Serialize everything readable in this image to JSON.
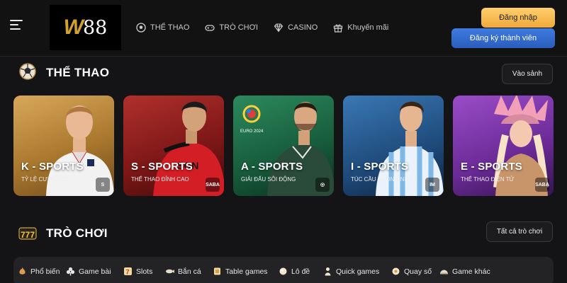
{
  "header": {
    "logo_text_w": "W",
    "logo_text_num": "88",
    "nav": [
      {
        "label": "THỂ THAO",
        "icon": "soccer-ball-icon"
      },
      {
        "label": "TRÒ CHƠI",
        "icon": "gamepad-icon"
      },
      {
        "label": "CASINO",
        "icon": "diamond-icon"
      },
      {
        "label": "Khuyến mãi",
        "icon": "gift-icon"
      }
    ],
    "login_label": "Đăng nhập",
    "register_label": "Đăng ký thành viên"
  },
  "sports": {
    "title": "THỂ THAO",
    "button": "Vào sảnh",
    "cards": [
      {
        "title": "K - SPORTS",
        "subtitle": "TỶ LỆ CƯỢC TỐT",
        "badge": "S",
        "color": "#b98a3a"
      },
      {
        "title": "S - SPORTS",
        "subtitle": "THỂ THAO ĐỈNH CAO",
        "badge": "SABA",
        "color": "#9c2a2a"
      },
      {
        "title": "A - SPORTS",
        "subtitle": "GIẢI ĐẤU SÔI ĐỘNG",
        "badge": "◎",
        "color": "#1f6b48"
      },
      {
        "title": "I - SPORTS",
        "subtitle": "TÚC CẦU CUỒNG NHIỆT",
        "badge": "IM",
        "color": "#2c5a86"
      },
      {
        "title": "E - SPORTS",
        "subtitle": "THỂ THAO ĐIỆN TỬ",
        "badge": "SABA",
        "color": "#7a3aa0"
      }
    ]
  },
  "games": {
    "title": "TRÒ CHƠI",
    "button": "Tất cả trò chơi",
    "categories": [
      {
        "label": "Phổ biến",
        "icon": "fire-icon"
      },
      {
        "label": "Game bài",
        "icon": "club-card-icon"
      },
      {
        "label": "Slots",
        "icon": "slot-seven-icon"
      },
      {
        "label": "Bắn cá",
        "icon": "fish-icon"
      },
      {
        "label": "Table games",
        "icon": "table-game-icon"
      },
      {
        "label": "Lô đề",
        "icon": "lottery-ball-icon"
      },
      {
        "label": "Quick games",
        "icon": "quick-game-icon"
      },
      {
        "label": "Quay số",
        "icon": "dice-ball-icon"
      },
      {
        "label": "Game khác",
        "icon": "other-game-icon"
      }
    ]
  },
  "colors": {
    "accent_gold": "#f0a93a",
    "accent_blue": "#2a5dbd",
    "background": "#141416"
  }
}
